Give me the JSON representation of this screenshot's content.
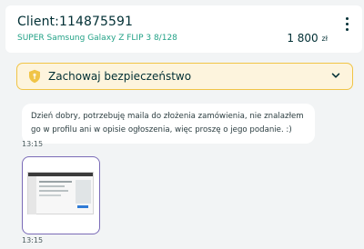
{
  "header": {
    "client_title": "Client:114875591",
    "ad_title": "SUPER Samsung Galaxy Z FLIP 3 8/128",
    "price_value": "1 800",
    "price_currency": "zł",
    "more_icon": "more-vertical-icon"
  },
  "safety_banner": {
    "label": "Zachowaj bezpieczeństwo",
    "icon": "shield-icon",
    "toggle_icon": "chevron-down-icon",
    "accent": "#f0c446",
    "background": "#fdf4dd"
  },
  "messages": [
    {
      "text": "Dzień dobry, potrzebuję maila do złożenia zamówienia, nie znalazłem go w profilu ani w opisie ogłoszenia, więc proszę o jego podanie. :)",
      "time": "13:15"
    },
    {
      "attachment": "screenshot-image",
      "time": "13:15"
    }
  ],
  "colors": {
    "link_green": "#23a287",
    "text_dark": "#002f34",
    "attachment_border": "#7a6bb7"
  }
}
